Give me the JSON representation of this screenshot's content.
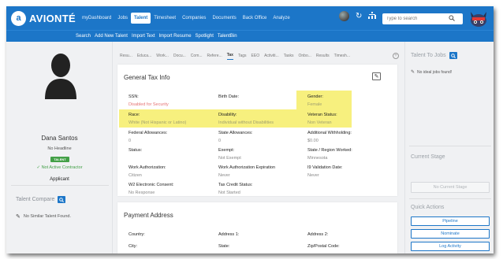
{
  "brand": {
    "name": "AVIONTÉ"
  },
  "main_nav": [
    "myDashboard",
    "Jobs",
    "Talent",
    "Timesheet",
    "Companies",
    "Documents",
    "Back Office",
    "Analyze"
  ],
  "main_nav_active": "Talent",
  "search": {
    "placeholder": "Type to search"
  },
  "sub_nav": [
    "Search",
    "Add New Talent",
    "Import Text",
    "Import Resume",
    "Spotlight",
    "TalentBin"
  ],
  "profile": {
    "name": "Dana Santos",
    "headline": "No Headline",
    "badge": "TALENT",
    "contractor_status": "Not Active Contractor",
    "type": "Applicant"
  },
  "talent_compare": {
    "title": "Talent Compare",
    "empty": "No Similar Talent Found."
  },
  "tabs": [
    "Resu...",
    "Educa...",
    "Work...",
    "Docu...",
    "Com...",
    "Refere...",
    "Tax",
    "Tags",
    "EEO",
    "Activiti...",
    "Tasks",
    "Onbo...",
    "Results",
    "Timesh..."
  ],
  "active_tab": "Tax",
  "tax_card": {
    "title": "General Tax Info",
    "fields": {
      "ssn": {
        "label": "SSN:",
        "value": "Disabled for Security"
      },
      "birth_date": {
        "label": "Birth Date:",
        "value": ""
      },
      "gender": {
        "label": "Gender:",
        "value": "Female"
      },
      "race": {
        "label": "Race:",
        "value": "White (Not Hispanic or Latino)"
      },
      "disability": {
        "label": "Disability:",
        "value": "Individual without Disabilities"
      },
      "veteran": {
        "label": "Veteran Status:",
        "value": "Non Veteran"
      },
      "federal_allow": {
        "label": "Federal Allowances:",
        "value": "0"
      },
      "state_allow": {
        "label": "State Allowances:",
        "value": "0"
      },
      "add_withholding": {
        "label": "Additional Withholding:",
        "value": "$0.00"
      },
      "status": {
        "label": "Status:",
        "value": ""
      },
      "exempt": {
        "label": "Exempt:",
        "value": "Not Exempt"
      },
      "state_region": {
        "label": "State / Region Worked:",
        "value": "Minnesota"
      },
      "work_auth": {
        "label": "Work Authorization:",
        "value": "Citizen"
      },
      "work_auth_exp": {
        "label": "Work Authorization Expiration",
        "value": "Never"
      },
      "i9": {
        "label": "I9 Validation Date:",
        "value": "Never"
      },
      "w2": {
        "label": "W2 Electronic Consent:",
        "value": "No Response"
      },
      "tax_credit": {
        "label": "Tax Credit Status:",
        "value": "Not Started"
      }
    }
  },
  "payment_card": {
    "title": "Payment Address",
    "fields": {
      "country": "Country:",
      "address1": "Address 1:",
      "address2": "Address 2:",
      "city": "City:",
      "state": "State:",
      "zip": "Zip/Postal Code:"
    }
  },
  "right": {
    "talent_to_jobs": "Talent To Jobs",
    "no_jobs": "No ideal jobs found!",
    "current_stage": "Current Stage",
    "no_stage": "No Current Stage",
    "quick_actions": "Quick Actions",
    "actions": [
      "Pipeline",
      "Nominate",
      "Log Activity"
    ]
  },
  "colors": {
    "brand_blue": "#1c76c8",
    "highlight": "#f7f07e",
    "success_green": "#43a047"
  }
}
